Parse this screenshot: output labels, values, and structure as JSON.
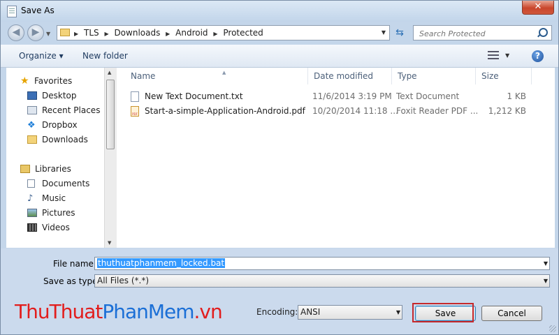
{
  "window": {
    "title": "Save As",
    "close_label": "✕"
  },
  "address": {
    "breadcrumbs": [
      "TLS",
      "Downloads",
      "Android",
      "Protected"
    ]
  },
  "search": {
    "placeholder": "Search Protected"
  },
  "toolbar": {
    "organize_label": "Organize ▾",
    "new_folder_label": "New folder",
    "help_label": "?"
  },
  "nav_pane": {
    "favorites": {
      "label": "Favorites",
      "items": [
        {
          "label": "Desktop",
          "icon": "desktop-icon"
        },
        {
          "label": "Recent Places",
          "icon": "recent-places-icon"
        },
        {
          "label": "Dropbox",
          "icon": "dropbox-icon"
        },
        {
          "label": "Downloads",
          "icon": "downloads-icon"
        }
      ]
    },
    "libraries": {
      "label": "Libraries",
      "items": [
        {
          "label": "Documents",
          "icon": "documents-icon"
        },
        {
          "label": "Music",
          "icon": "music-icon"
        },
        {
          "label": "Pictures",
          "icon": "pictures-icon"
        },
        {
          "label": "Videos",
          "icon": "videos-icon"
        }
      ]
    }
  },
  "file_list": {
    "columns": {
      "name": "Name",
      "date": "Date modified",
      "type": "Type",
      "size": "Size"
    },
    "rows": [
      {
        "name": "New Text Document.txt",
        "date": "11/6/2014 3:19 PM",
        "type": "Text Document",
        "size": "1 KB",
        "icon": "text-file-icon"
      },
      {
        "name": "Start-a-simple-Application-Android.pdf",
        "date": "10/20/2014 11:18 ...",
        "type": "Foxit Reader PDF ...",
        "size": "1,212 KB",
        "icon": "pdf-file-icon"
      }
    ]
  },
  "form": {
    "file_name_label": "File name:",
    "file_name_value": "thuthuatphanmem_locked.bat",
    "save_type_label": "Save as type:",
    "save_type_value": "All Files  (*.*)",
    "encoding_label": "Encoding:",
    "encoding_value": "ANSI",
    "save_label": "Save",
    "cancel_label": "Cancel"
  },
  "watermark": {
    "part1": "ThuThuat",
    "part2": "PhanMem",
    "part3": ".vn"
  },
  "colors": {
    "accent": "#3399ff",
    "highlight_box": "#c6282b",
    "watermark_red": "#e21d1d",
    "watermark_blue": "#1b6fd6"
  }
}
